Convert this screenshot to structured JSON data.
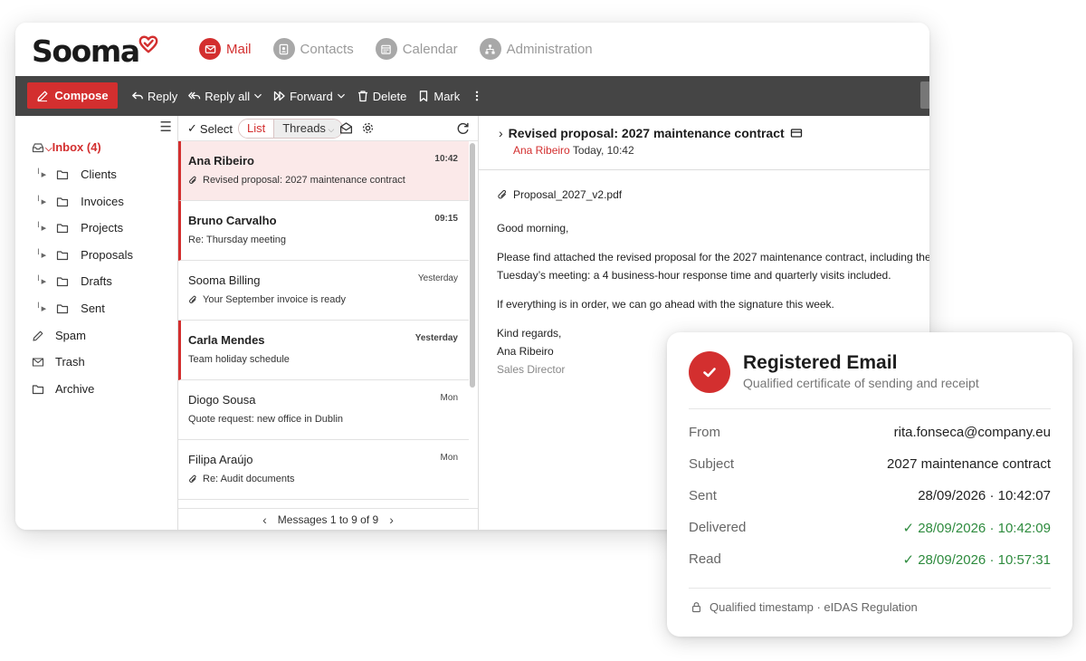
{
  "app": {
    "logo": "Sooma",
    "nav": [
      {
        "label": "Mail",
        "icon": "mail-icon",
        "active": true
      },
      {
        "label": "Contacts",
        "icon": "contacts-icon",
        "active": false
      },
      {
        "label": "Calendar",
        "icon": "calendar-icon",
        "active": false
      },
      {
        "label": "Administration",
        "icon": "admin-icon",
        "active": false
      }
    ],
    "accent": "#d32f2f"
  },
  "toolbar": {
    "compose": "Compose",
    "reply": "Reply",
    "reply_all": "Reply all",
    "forward": "Forward",
    "delete": "Delete",
    "mark": "Mark"
  },
  "folders": {
    "inbox": "Inbox (4)",
    "subfolders": [
      "Clients",
      "Invoices",
      "Projects",
      "Proposals",
      "Drafts",
      "Sent"
    ],
    "spam": "Spam",
    "trash": "Trash",
    "archive": "Archive"
  },
  "list": {
    "select": "Select",
    "view_list": "List",
    "view_threads": "Threads",
    "pager": "Messages 1 to 9 of 9",
    "messages": [
      {
        "sender": "Ana Ribeiro",
        "time": "10:42",
        "subject": "Revised proposal: 2027 maintenance contract",
        "attachment": true,
        "unread": true,
        "selected": true
      },
      {
        "sender": "Bruno Carvalho",
        "time": "09:15",
        "subject": "Re: Thursday meeting",
        "attachment": false,
        "unread": true,
        "selected": false
      },
      {
        "sender": "Sooma Billing",
        "time": "Yesterday",
        "subject": "Your September invoice is ready",
        "attachment": true,
        "unread": false,
        "selected": false
      },
      {
        "sender": "Carla Mendes",
        "time": "Yesterday",
        "subject": "Team holiday schedule",
        "attachment": false,
        "unread": true,
        "selected": false
      },
      {
        "sender": "Diogo Sousa",
        "time": "Mon",
        "subject": "Quote request: new office in Dublin",
        "attachment": false,
        "unread": false,
        "selected": false
      },
      {
        "sender": "Filipa Araújo",
        "time": "Mon",
        "subject": "Re: Audit documents",
        "attachment": true,
        "unread": false,
        "selected": false
      }
    ]
  },
  "reader": {
    "title": "Revised proposal: 2027 maintenance contract",
    "from": "Ana Ribeiro",
    "date": "Today, 10:42",
    "attachment": "Proposal_2027_v2.pdf",
    "greeting": "Good morning,",
    "para1_line1": "Please find attached the revised proposal for the 2027 maintenance contract, including the",
    "para1_line2": "Tuesday’s meeting: a 4 business-hour response time and quarterly visits included.",
    "para2": "If everything is in order, we can go ahead with the signature this week.",
    "closing": "Kind regards,",
    "signature_name": "Ana Ribeiro",
    "signature_role": "Sales Director"
  },
  "certificate": {
    "title": "Registered Email",
    "subtitle": "Qualified certificate of sending and receipt",
    "rows": [
      {
        "label": "From",
        "value": "rita.fonseca@company.eu",
        "verified": false
      },
      {
        "label": "Subject",
        "value": "2027 maintenance contract",
        "verified": false
      },
      {
        "label": "Sent",
        "value": "28/09/2026 · 10:42:07",
        "verified": false
      },
      {
        "label": "Delivered",
        "value": "✓ 28/09/2026 · 10:42:09",
        "verified": true
      },
      {
        "label": "Read",
        "value": "✓ 28/09/2026 · 10:57:31",
        "verified": true
      }
    ],
    "footer": "Qualified timestamp · eIDAS Regulation",
    "success_color": "#2e8b3e"
  }
}
